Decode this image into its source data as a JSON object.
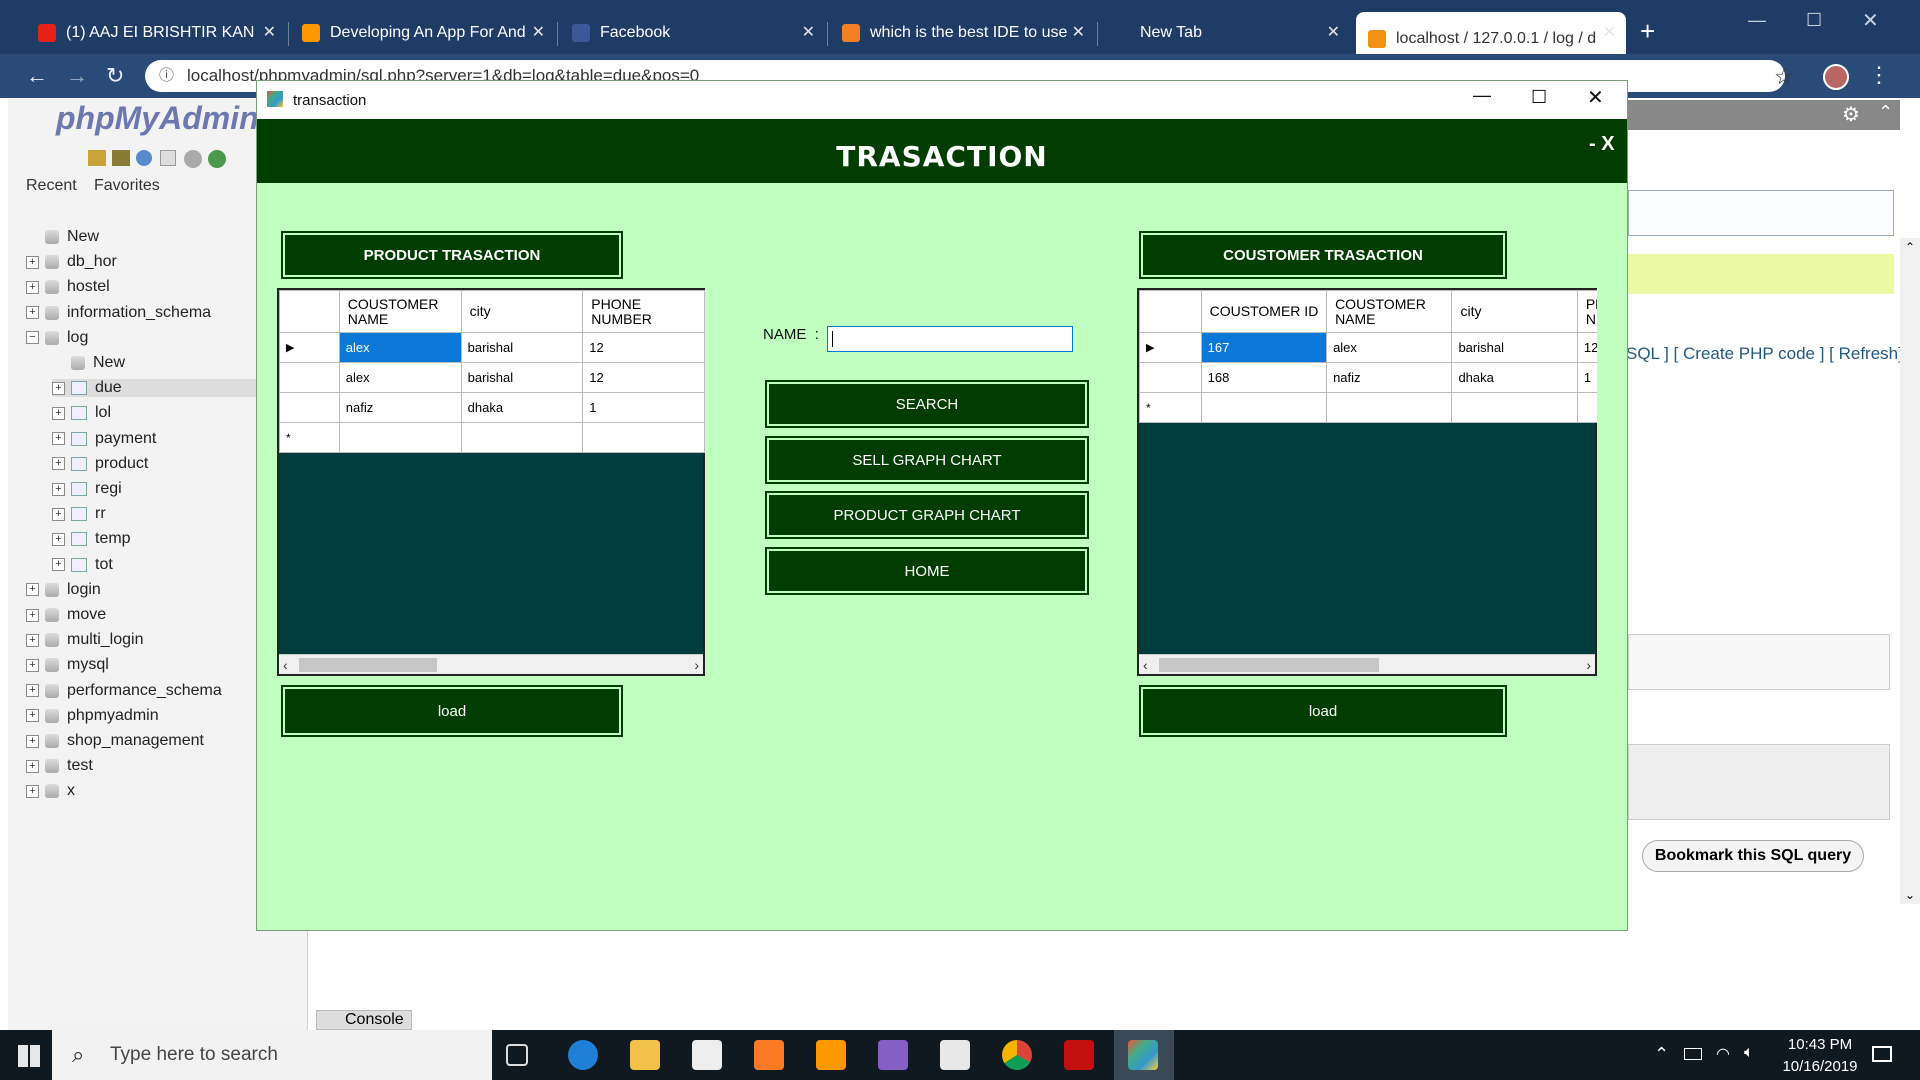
{
  "browser": {
    "tabs": [
      {
        "label": "(1) AAJ EI BRISHTIR KAN",
        "color": "#e62117"
      },
      {
        "label": "Developing An App For And",
        "color": "#ff9800"
      },
      {
        "label": "Facebook",
        "color": "#3b5998"
      },
      {
        "label": "which is the best IDE to use",
        "color": "#f48024"
      },
      {
        "label": "New Tab",
        "color": "#1f3c66"
      },
      {
        "label": "localhost / 127.0.0.1 / log / d",
        "color": "#f29111"
      }
    ],
    "url": "localhost/phpmyadmin/sql.php?server=1&db=log&table=due&pos=0"
  },
  "pma": {
    "logo": "phpMyAdmin",
    "tabs": [
      "Recent",
      "Favorites"
    ],
    "tree": [
      {
        "label": "New",
        "type": "new",
        "indent": 0
      },
      {
        "label": "db_hor",
        "type": "db",
        "indent": 0
      },
      {
        "label": "hostel",
        "type": "db",
        "indent": 0
      },
      {
        "label": "information_schema",
        "type": "db",
        "indent": 0
      },
      {
        "label": "log",
        "type": "db-open",
        "indent": 0
      },
      {
        "label": "New",
        "type": "new",
        "indent": 1
      },
      {
        "label": "due",
        "type": "tbl",
        "indent": 1
      },
      {
        "label": "lol",
        "type": "tbl",
        "indent": 1
      },
      {
        "label": "payment",
        "type": "tbl",
        "indent": 1
      },
      {
        "label": "product",
        "type": "tbl",
        "indent": 1
      },
      {
        "label": "regi",
        "type": "tbl",
        "indent": 1
      },
      {
        "label": "rr",
        "type": "tbl",
        "indent": 1
      },
      {
        "label": "temp",
        "type": "tbl",
        "indent": 1
      },
      {
        "label": "tot",
        "type": "tbl",
        "indent": 1
      },
      {
        "label": "login",
        "type": "db",
        "indent": 0
      },
      {
        "label": "move",
        "type": "db",
        "indent": 0
      },
      {
        "label": "multi_login",
        "type": "db",
        "indent": 0
      },
      {
        "label": "mysql",
        "type": "db",
        "indent": 0
      },
      {
        "label": "performance_schema",
        "type": "db",
        "indent": 0
      },
      {
        "label": "phpmyadmin",
        "type": "db",
        "indent": 0
      },
      {
        "label": "shop_management",
        "type": "db",
        "indent": 0
      },
      {
        "label": "test",
        "type": "db",
        "indent": 0
      },
      {
        "label": "x",
        "type": "db",
        "indent": 0
      }
    ],
    "links": "SQL ] [ Create PHP code ] [ Refresh]",
    "bookmark": "Bookmark this SQL query",
    "console": "Console"
  },
  "app": {
    "window_title": "transaction",
    "header": "TRASACTION",
    "header_controls": "- X",
    "product_panel": {
      "title": "PRODUCT TRASACTION",
      "columns": [
        "COUSTOMER NAME",
        "city",
        "PHONE NUMBER"
      ],
      "rows": [
        [
          "alex",
          "barishal",
          "12"
        ],
        [
          "alex",
          "barishal",
          "12"
        ],
        [
          "nafiz",
          "dhaka",
          "1"
        ]
      ],
      "load": "load"
    },
    "customer_panel": {
      "title": "COUSTOMER TRASACTION",
      "columns": [
        "COUSTOMER ID",
        "COUSTOMER NAME",
        "city",
        "PH N"
      ],
      "rows": [
        [
          "167",
          "alex",
          "barishal",
          "12"
        ],
        [
          "168",
          "nafiz",
          "dhaka",
          "1"
        ]
      ],
      "load": "load"
    },
    "name_label": "NAME  :",
    "name_value": "",
    "buttons": [
      "SEARCH",
      "SELL GRAPH CHART",
      "PRODUCT GRAPH CHART",
      "HOME"
    ]
  },
  "taskbar": {
    "search_placeholder": "Type here to search",
    "time": "10:43 PM",
    "date": "10/16/2019"
  }
}
